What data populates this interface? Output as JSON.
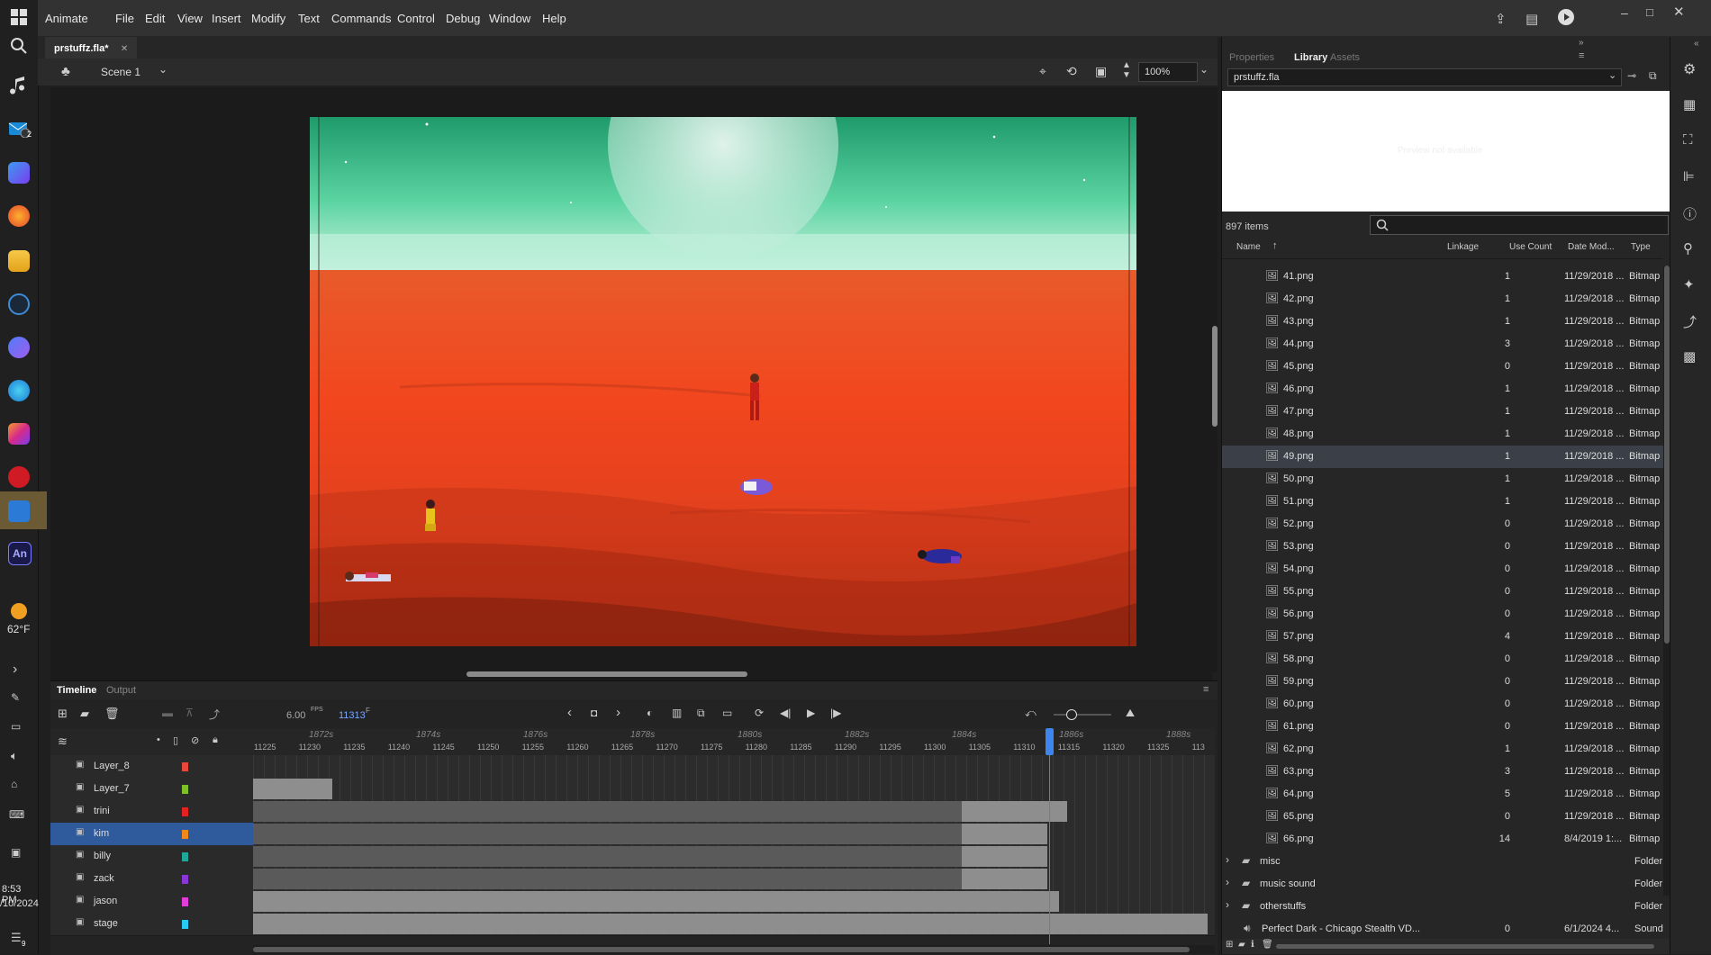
{
  "taskbar": {
    "weather": {
      "temp": "62°F"
    },
    "clock": {
      "time": "8:53 PM",
      "date": "/10/2024"
    },
    "mail_badge": "2",
    "notif_badge": "9"
  },
  "app": {
    "name": "Animate",
    "menu": [
      "File",
      "Edit",
      "View",
      "Insert",
      "Modify",
      "Text",
      "Commands",
      "Control",
      "Debug",
      "Window",
      "Help"
    ]
  },
  "document": {
    "tab": "prstuffz.fla*",
    "scene": "Scene 1",
    "zoom": "100%"
  },
  "timeline": {
    "tabs": [
      "Timeline",
      "Output"
    ],
    "fps": "6.00",
    "fps_unit": "FPS",
    "current_frame": "11313",
    "frame_unit": "F",
    "time_markers": [
      "1872s",
      "1874s",
      "1876s",
      "1878s",
      "1880s",
      "1882s",
      "1884s",
      "1886s",
      "1888s"
    ],
    "frame_numbers": [
      "11225",
      "11230",
      "11235",
      "11240",
      "11245",
      "11250",
      "11255",
      "11260",
      "11265",
      "11270",
      "11275",
      "11280",
      "11285",
      "11290",
      "11295",
      "11300",
      "11305",
      "11310",
      "11315",
      "11320",
      "11325",
      "113"
    ],
    "layers": [
      {
        "name": "Layer_8",
        "color": "#e8473b",
        "selected": false
      },
      {
        "name": "Layer_7",
        "color": "#7fbf27",
        "selected": false
      },
      {
        "name": "trini",
        "color": "#e52121",
        "selected": false
      },
      {
        "name": "kim",
        "color": "#ee8a1c",
        "selected": true
      },
      {
        "name": "billy",
        "color": "#1fa89a",
        "selected": false
      },
      {
        "name": "zack",
        "color": "#8a35d6",
        "selected": false
      },
      {
        "name": "jason",
        "color": "#e23dd9",
        "selected": false
      },
      {
        "name": "stage",
        "color": "#28c9f2",
        "selected": false
      }
    ]
  },
  "library": {
    "tabs": [
      "Properties",
      "Library",
      "Assets"
    ],
    "active_tab": "Library",
    "document": "prstuffz.fla",
    "preview_text": "Preview not available",
    "item_count": "897 items",
    "columns": [
      "Name",
      "Linkage",
      "Use Count",
      "Date Mod...",
      "Type"
    ],
    "items": [
      {
        "name": "41.png",
        "use": "1",
        "date": "11/29/2018 ...",
        "type": "Bitmap"
      },
      {
        "name": "42.png",
        "use": "1",
        "date": "11/29/2018 ...",
        "type": "Bitmap"
      },
      {
        "name": "43.png",
        "use": "1",
        "date": "11/29/2018 ...",
        "type": "Bitmap"
      },
      {
        "name": "44.png",
        "use": "3",
        "date": "11/29/2018 ...",
        "type": "Bitmap"
      },
      {
        "name": "45.png",
        "use": "0",
        "date": "11/29/2018 ...",
        "type": "Bitmap"
      },
      {
        "name": "46.png",
        "use": "1",
        "date": "11/29/2018 ...",
        "type": "Bitmap"
      },
      {
        "name": "47.png",
        "use": "1",
        "date": "11/29/2018 ...",
        "type": "Bitmap"
      },
      {
        "name": "48.png",
        "use": "1",
        "date": "11/29/2018 ...",
        "type": "Bitmap"
      },
      {
        "name": "49.png",
        "use": "1",
        "date": "11/29/2018 ...",
        "type": "Bitmap"
      },
      {
        "name": "50.png",
        "use": "1",
        "date": "11/29/2018 ...",
        "type": "Bitmap"
      },
      {
        "name": "51.png",
        "use": "1",
        "date": "11/29/2018 ...",
        "type": "Bitmap"
      },
      {
        "name": "52.png",
        "use": "0",
        "date": "11/29/2018 ...",
        "type": "Bitmap"
      },
      {
        "name": "53.png",
        "use": "0",
        "date": "11/29/2018 ...",
        "type": "Bitmap"
      },
      {
        "name": "54.png",
        "use": "0",
        "date": "11/29/2018 ...",
        "type": "Bitmap"
      },
      {
        "name": "55.png",
        "use": "0",
        "date": "11/29/2018 ...",
        "type": "Bitmap"
      },
      {
        "name": "56.png",
        "use": "0",
        "date": "11/29/2018 ...",
        "type": "Bitmap"
      },
      {
        "name": "57.png",
        "use": "4",
        "date": "11/29/2018 ...",
        "type": "Bitmap"
      },
      {
        "name": "58.png",
        "use": "0",
        "date": "11/29/2018 ...",
        "type": "Bitmap"
      },
      {
        "name": "59.png",
        "use": "0",
        "date": "11/29/2018 ...",
        "type": "Bitmap"
      },
      {
        "name": "60.png",
        "use": "0",
        "date": "11/29/2018 ...",
        "type": "Bitmap"
      },
      {
        "name": "61.png",
        "use": "0",
        "date": "11/29/2018 ...",
        "type": "Bitmap"
      },
      {
        "name": "62.png",
        "use": "1",
        "date": "11/29/2018 ...",
        "type": "Bitmap"
      },
      {
        "name": "63.png",
        "use": "3",
        "date": "11/29/2018 ...",
        "type": "Bitmap"
      },
      {
        "name": "64.png",
        "use": "5",
        "date": "11/29/2018 ...",
        "type": "Bitmap"
      },
      {
        "name": "65.png",
        "use": "0",
        "date": "11/29/2018 ...",
        "type": "Bitmap"
      },
      {
        "name": "66.png",
        "use": "14",
        "date": "8/4/2019 1:...",
        "type": "Bitmap"
      }
    ],
    "folders": [
      {
        "name": "misc",
        "type": "Folder"
      },
      {
        "name": "music sound",
        "type": "Folder"
      },
      {
        "name": "otherstuffs",
        "type": "Folder"
      }
    ],
    "sound_item": {
      "name": "Perfect Dark - Chicago Stealth VD...",
      "use": "0",
      "date": "6/1/2024 4...",
      "type": "Sound"
    }
  }
}
